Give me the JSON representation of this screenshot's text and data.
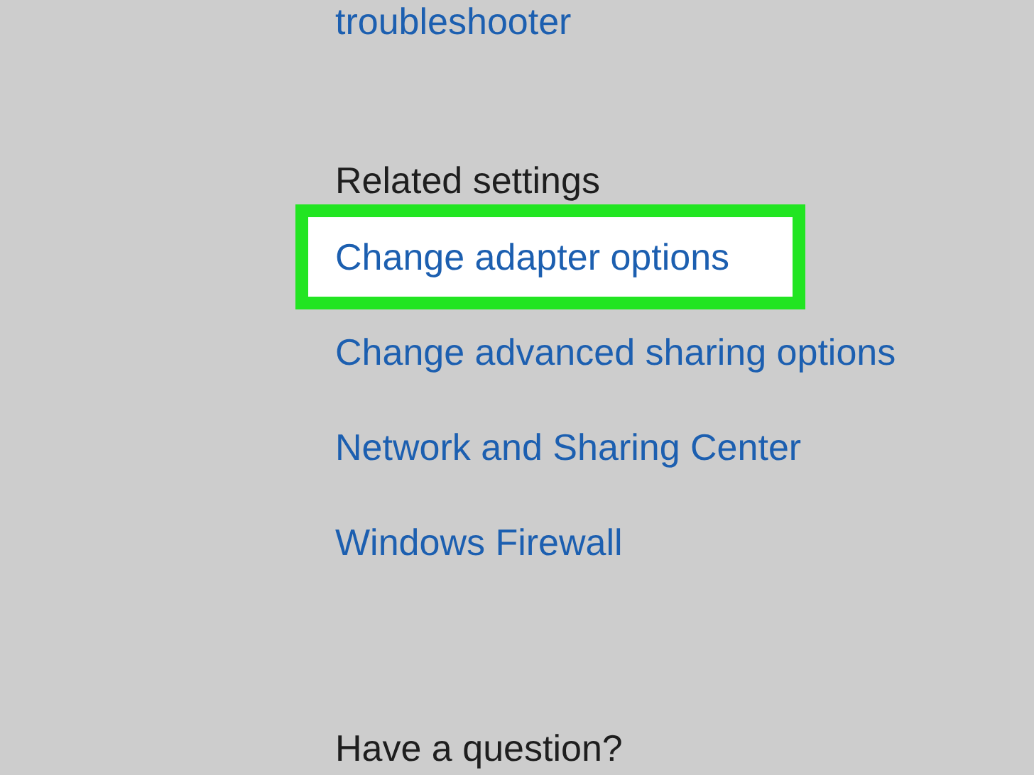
{
  "top_link": "troubleshooter",
  "related_settings": {
    "heading": "Related settings",
    "links": [
      {
        "label": "Change adapter options",
        "selected": true
      },
      {
        "label": "Change advanced sharing options",
        "selected": false
      },
      {
        "label": "Network and Sharing Center",
        "selected": false
      },
      {
        "label": "Windows Firewall",
        "selected": false
      }
    ]
  },
  "help_heading": "Have a question?"
}
